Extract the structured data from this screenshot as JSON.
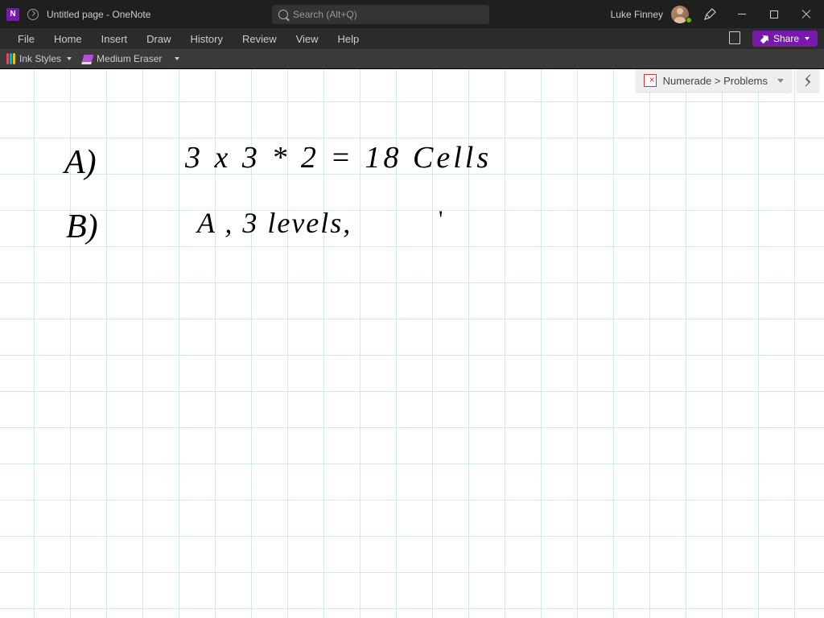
{
  "titlebar": {
    "app_badge": "N",
    "doc_title": "Untitled page  -  OneNote",
    "search_placeholder": "Search (Alt+Q)",
    "user_name": "Luke Finney"
  },
  "ribbon": {
    "tabs": [
      "File",
      "Home",
      "Insert",
      "Draw",
      "History",
      "Review",
      "View",
      "Help"
    ],
    "share_label": "Share"
  },
  "toolbar": {
    "ink_styles_label": "Ink Styles",
    "eraser_label": "Medium Eraser"
  },
  "breadcrumb": {
    "path": "Numerade > Problems"
  },
  "ink_strokes": {
    "line_a_label": "A)",
    "line_a_eq": "3 x 3 * 2 = 18   Cells",
    "line_b_label": "B)",
    "line_b_text": "A , 3 levels,",
    "tick": "'"
  }
}
